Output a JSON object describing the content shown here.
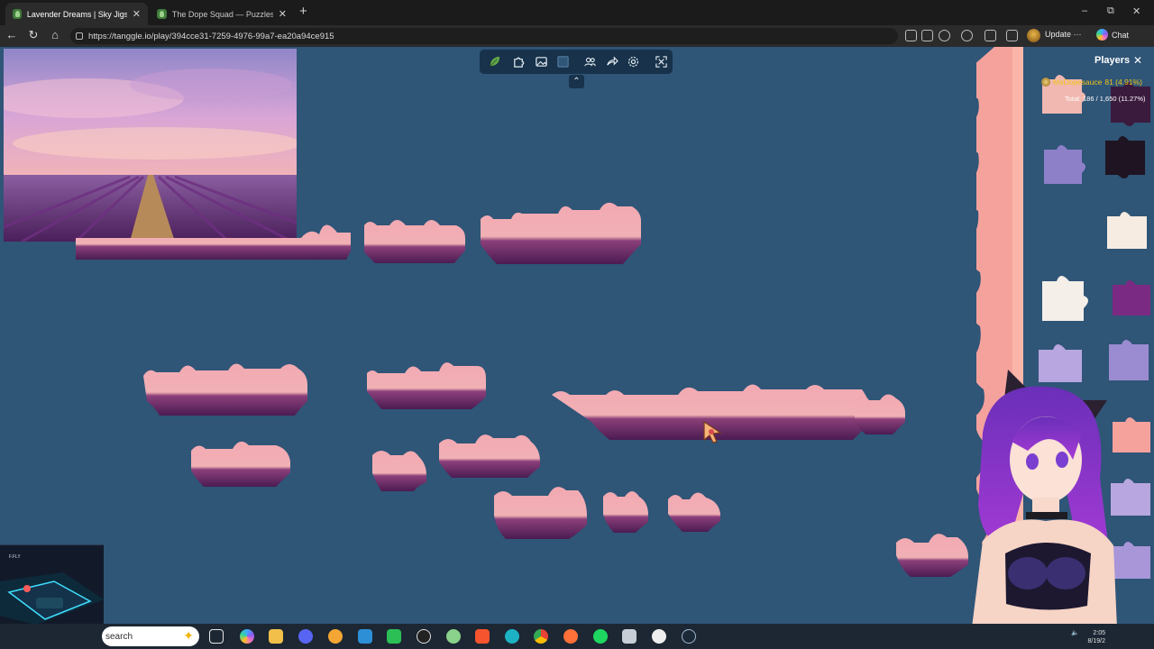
{
  "browser": {
    "tabs": [
      {
        "title": "Lavender Dreams | Sky Jigsaw",
        "active": true
      },
      {
        "title": "The Dope Squad — Puzzles",
        "active": false
      }
    ],
    "new_tab_label": "+",
    "window_controls": {
      "minimize": "–",
      "maximize": "⧉",
      "close": "✕"
    },
    "url": "https://tanggle.io/play/394cce31-7259-4976-99a7-ea20a94ce915",
    "update_label": "Update ···",
    "chat_label": "Chat"
  },
  "game": {
    "toolbar_icons": [
      "leaf-logo-icon",
      "puzzle-pieces-icon",
      "preview-image-icon",
      "background-color-icon",
      "players-icon",
      "share-icon",
      "settings-icon",
      "fullscreen-icon"
    ],
    "collapse_glyph": "⌃",
    "players_panel": {
      "title": "Players",
      "close": "✕",
      "player_name": "MsDopesauce",
      "player_stats": "81 (4.91%)",
      "total": "Total: 186 / 1,650 (11.27%)"
    },
    "colors": {
      "board": "#2f5577",
      "toolbar": "#17324a",
      "sky": "#f0a8ae",
      "lavender": "#5a2660",
      "border_strip": "#f6a2a0"
    }
  },
  "taskbar": {
    "search_placeholder": "search",
    "clock_time": "2:05",
    "clock_date": "8/19/2"
  }
}
